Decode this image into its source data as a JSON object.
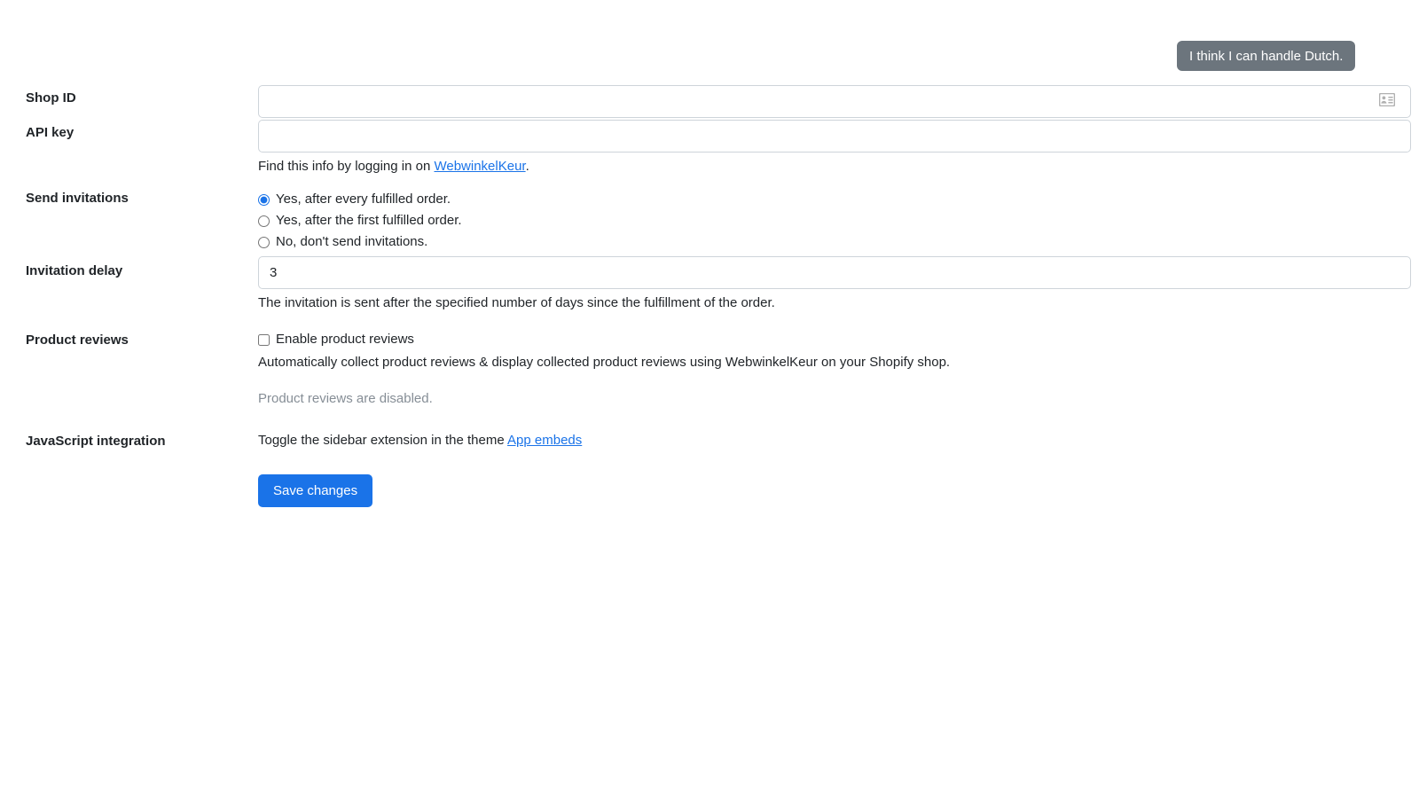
{
  "tooltip": {
    "text": "I think I can handle Dutch."
  },
  "form": {
    "shop_id": {
      "label": "Shop ID",
      "value": "",
      "placeholder": "",
      "icon": "contact-card-autofill-icon"
    },
    "api_key": {
      "label": "API key",
      "value": "",
      "placeholder": "",
      "help_prefix": "Find this info by logging in on ",
      "help_link": "WebwinkelKeur",
      "help_suffix": "."
    },
    "send_invitations": {
      "label": "Send invitations",
      "options": [
        {
          "label": "Yes, after every fulfilled order.",
          "checked": true
        },
        {
          "label": "Yes, after the first fulfilled order.",
          "checked": false
        },
        {
          "label": "No, don't send invitations.",
          "checked": false
        }
      ]
    },
    "invitation_delay": {
      "label": "Invitation delay",
      "value": "3",
      "help": "The invitation is sent after the specified number of days since the fulfillment of the order."
    },
    "product_reviews": {
      "label": "Product reviews",
      "checkbox_label": "Enable product reviews",
      "checked": false,
      "description": "Automatically collect product reviews & display collected product reviews using WebwinkelKeur on your Shopify shop.",
      "status": "Product reviews are disabled."
    },
    "javascript_integration": {
      "label": "JavaScript integration",
      "text_prefix": "Toggle the sidebar extension in the theme ",
      "link": "App embeds"
    },
    "save_button": "Save changes"
  },
  "colors": {
    "accent": "#1a73e8",
    "tooltip_bg": "#6c757d",
    "label": "#212529",
    "muted": "#868e96",
    "border": "#ced4da"
  }
}
